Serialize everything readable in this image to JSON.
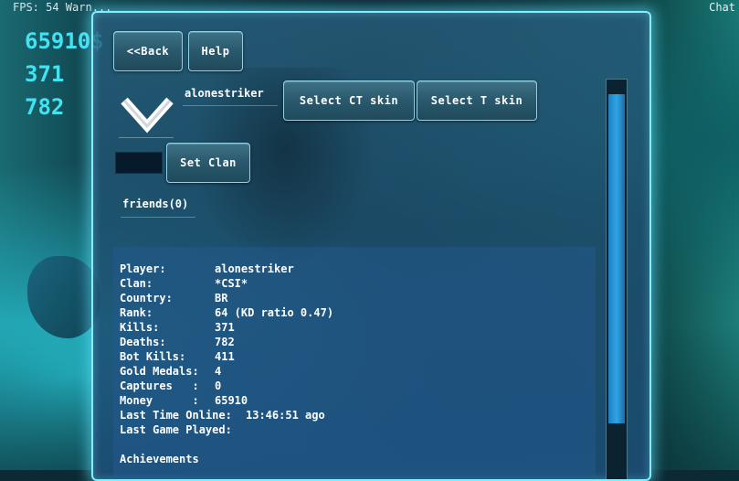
{
  "hud": {
    "top_text": "FPS: 54 Warn...",
    "chat": "Chat",
    "money": "65910$",
    "kills": "371",
    "deaths": "782"
  },
  "buttons": {
    "back": "<<Back",
    "help": "Help",
    "select_ct": "Select CT skin",
    "select_t": "Select T skin",
    "set_clan": "Set Clan"
  },
  "profile": {
    "name": "alonestriker",
    "friends": "friends(0)"
  },
  "info": [
    {
      "label": "Player:",
      "value": "alonestriker"
    },
    {
      "label": "Clan:",
      "value": "*CSI*"
    },
    {
      "label": "Country:",
      "value": "BR"
    },
    {
      "label": "Rank:",
      "value": "64 (KD ratio 0.47)"
    },
    {
      "label": "Kills:",
      "value": "371"
    },
    {
      "label": "Deaths:",
      "value": "782"
    },
    {
      "label": "Bot Kills:",
      "value": "411"
    },
    {
      "label": "Gold Medals:",
      "value": "4"
    },
    {
      "label": "Captures   :",
      "value": "0"
    },
    {
      "label": "Money      :",
      "value": "65910"
    },
    {
      "label": "Last Time Online:",
      "value": "13:46:51 ago"
    },
    {
      "label": "Last Game Played:",
      "value": ""
    },
    {
      "label": "",
      "value": ""
    },
    {
      "label": "Achievements",
      "value": ""
    }
  ],
  "colors": {
    "accent": "#41e3f3",
    "panel_border": "#7ff0ff",
    "scroll_thumb": "#2fa4e6"
  },
  "icons": {
    "rank": "chevron-rank-icon"
  }
}
